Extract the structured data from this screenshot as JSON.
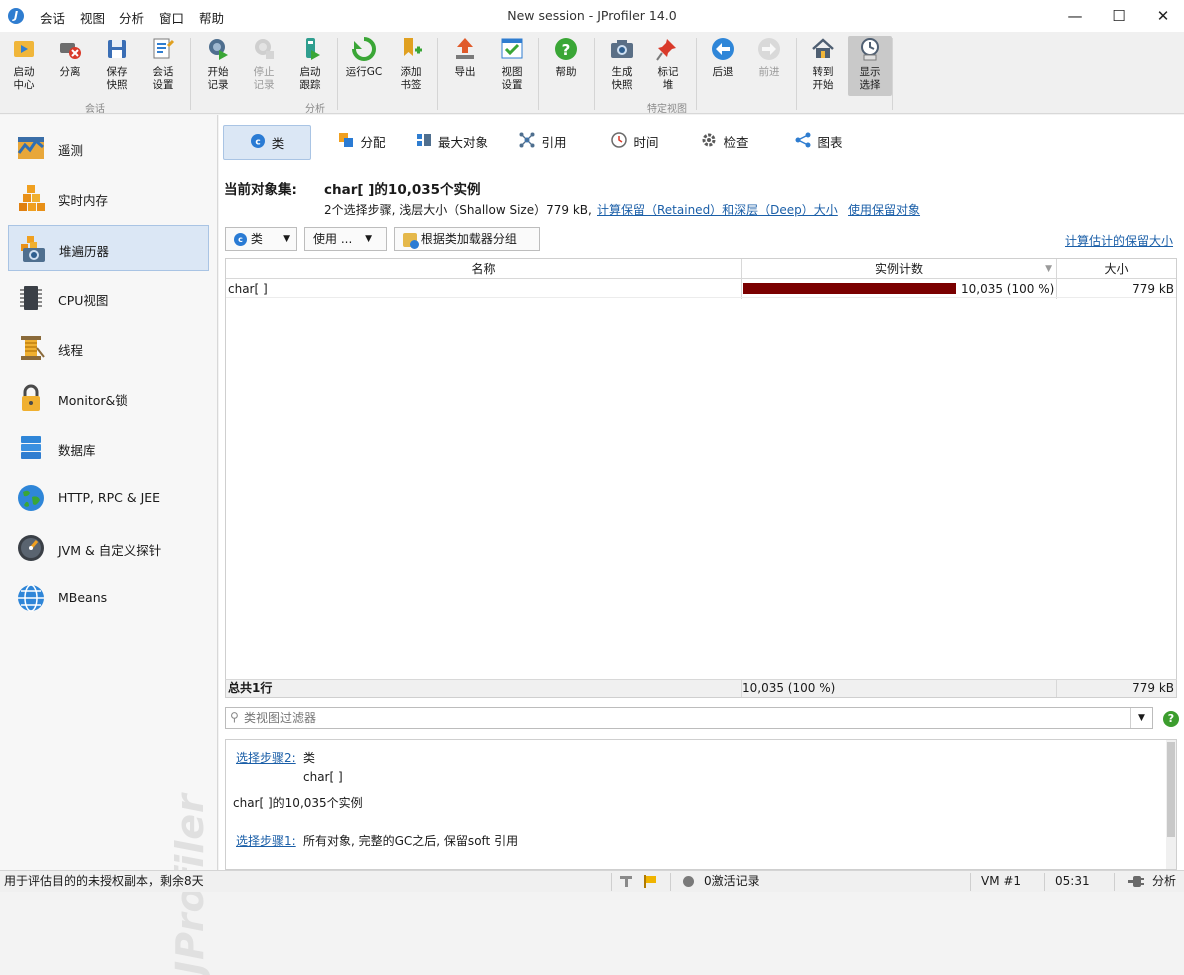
{
  "window": {
    "title": "New session - JProfiler 14.0",
    "logo_glyph": "J"
  },
  "menu": [
    "会话",
    "视图",
    "分析",
    "窗口",
    "帮助"
  ],
  "window_controls": {
    "minimize": "—",
    "maximize": "☐",
    "close": "✕"
  },
  "toolbar": {
    "groups": [
      "会话",
      "分析",
      "特定视图"
    ],
    "buttons": [
      {
        "label": "启动\n中心",
        "icon": "launch-center-icon",
        "enabled": true
      },
      {
        "label": "分离",
        "icon": "detach-icon",
        "enabled": true
      },
      {
        "label": "保存\n快照",
        "icon": "save-snapshot-icon",
        "enabled": true
      },
      {
        "label": "会话\n设置",
        "icon": "session-settings-icon",
        "enabled": true
      },
      {
        "label": "开始\n记录",
        "icon": "start-recording-icon",
        "enabled": true
      },
      {
        "label": "停止\n记录",
        "icon": "stop-recording-icon",
        "enabled": false
      },
      {
        "label": "启动\n跟踪",
        "icon": "start-tracking-icon",
        "enabled": true
      },
      {
        "label": "运行GC",
        "icon": "run-gc-icon",
        "enabled": true
      },
      {
        "label": "添加\n书签",
        "icon": "add-bookmark-icon",
        "enabled": true
      },
      {
        "label": "导出",
        "icon": "export-icon",
        "enabled": true
      },
      {
        "label": "视图\n设置",
        "icon": "view-settings-icon",
        "enabled": true
      },
      {
        "label": "帮助",
        "icon": "help-icon",
        "enabled": true
      },
      {
        "label": "生成\n快照",
        "icon": "camera-icon",
        "enabled": true
      },
      {
        "label": "标记\n堆",
        "icon": "pin-icon",
        "enabled": true
      },
      {
        "label": "后退",
        "icon": "back-icon",
        "enabled": true
      },
      {
        "label": "前进",
        "icon": "forward-icon",
        "enabled": false
      },
      {
        "label": "转到\n开始",
        "icon": "home-icon",
        "enabled": true
      },
      {
        "label": "显示\n选择",
        "icon": "show-selection-icon",
        "enabled": true,
        "selected": true
      }
    ]
  },
  "sidebar": {
    "items": [
      {
        "label": "遥测",
        "icon": "telemetry-icon"
      },
      {
        "label": "实时内存",
        "icon": "live-memory-icon"
      },
      {
        "label": "堆遍历器",
        "icon": "heap-walker-icon",
        "active": true
      },
      {
        "label": "CPU视图",
        "icon": "cpu-icon"
      },
      {
        "label": "线程",
        "icon": "threads-icon"
      },
      {
        "label": "Monitor&锁",
        "icon": "lock-icon"
      },
      {
        "label": "数据库",
        "icon": "database-icon"
      },
      {
        "label": "HTTP, RPC & JEE",
        "icon": "globe-icon"
      },
      {
        "label": "JVM & 自定义探针",
        "icon": "gauge-icon"
      },
      {
        "label": "MBeans",
        "icon": "mbeans-globe-icon"
      }
    ],
    "watermark": "JProfiler"
  },
  "view_tabs": [
    {
      "label": "类",
      "icon": "class-icon",
      "active": true
    },
    {
      "label": "分配",
      "icon": "allocation-icon"
    },
    {
      "label": "最大对象",
      "icon": "biggest-objects-icon"
    },
    {
      "label": "引用",
      "icon": "references-icon"
    },
    {
      "label": "时间",
      "icon": "time-icon"
    },
    {
      "label": "检查",
      "icon": "inspection-icon"
    },
    {
      "label": "图表",
      "icon": "graph-icon"
    }
  ],
  "object_set": {
    "label": "当前对象集:",
    "value": "char[ ]的10,035个实例",
    "details": "2个选择步骤, 浅层大小（Shallow Size）779 kB,",
    "link_retained": "计算保留（Retained）和深层（Deep）大小",
    "link_use_retained": "使用保留对象"
  },
  "controls": {
    "class_dropdown": "类",
    "use_dropdown": "使用 ...",
    "group_by_classloader": "根据类加载器分组",
    "calc_retained_link": "计算估计的保留大小"
  },
  "table": {
    "columns": [
      "名称",
      "实例计数",
      "大小"
    ],
    "rows": [
      {
        "name": "char[ ]",
        "count_text": "10,035 (100 %)",
        "fraction": 1.0,
        "size": "779 kB"
      }
    ],
    "total": {
      "label": "总共1行",
      "count_text": "10,035 (100 %)",
      "size": "779 kB"
    },
    "bar_color": "#7a0000"
  },
  "filter": {
    "placeholder": "类视图过滤器"
  },
  "steps": {
    "step2_link": "选择步骤2:",
    "step2_kind": "类",
    "step2_value": "char[ ]",
    "step2_result": "char[ ]的10,035个实例",
    "step1_link": "选择步骤1:",
    "step1_text": "所有对象, 完整的GC之后, 保留soft 引用"
  },
  "statusbar": {
    "license": "用于评估目的的未授权副本，剩余8天",
    "recordings": "0激活记录",
    "vm": "VM #1",
    "time": "05:31",
    "mode": "分析"
  }
}
